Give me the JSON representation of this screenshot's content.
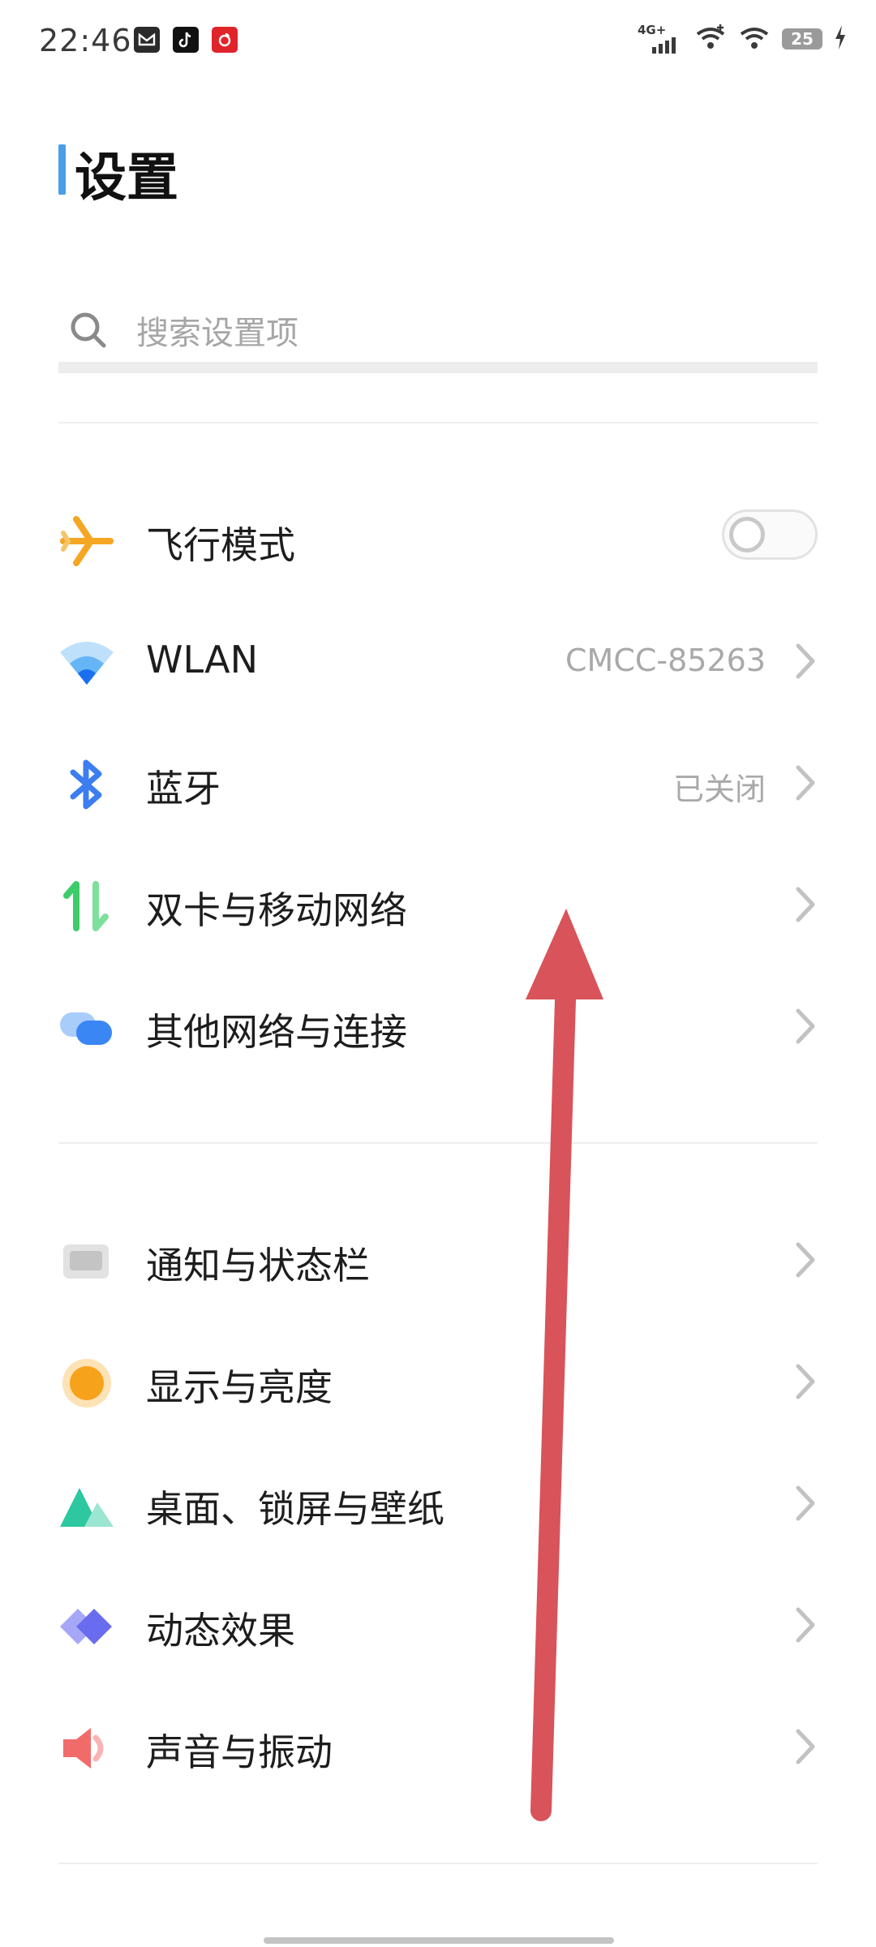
{
  "status_bar": {
    "time": "22:46",
    "network_label": "4G+",
    "battery_level": "25",
    "notification_icons": [
      "message-app-icon",
      "tiktok-app-icon",
      "netease-music-app-icon"
    ]
  },
  "page": {
    "title": "设置",
    "accent_color": "#4a9ee8"
  },
  "search": {
    "placeholder": "搜索设置项"
  },
  "settings": {
    "airplane": {
      "label": "飞行模式",
      "enabled": false,
      "icon": "airplane-icon",
      "color": "#f5a623"
    },
    "wlan": {
      "label": "WLAN",
      "value": "CMCC-85263",
      "icon": "wifi-icon",
      "color": "#2d7ff9"
    },
    "bluetooth": {
      "label": "蓝牙",
      "value": "已关闭",
      "icon": "bluetooth-icon",
      "color": "#3c7ef0"
    },
    "mobile": {
      "label": "双卡与移动网络",
      "icon": "mobile-data-icon",
      "color": "#3dcc6a"
    },
    "other_network": {
      "label": "其他网络与连接",
      "icon": "other-connections-icon",
      "color": "#3a86f5"
    },
    "notifications": {
      "label": "通知与状态栏",
      "icon": "notification-icon",
      "color": "#c4c4c4"
    },
    "display": {
      "label": "显示与亮度",
      "icon": "brightness-icon",
      "color": "#f7a21b"
    },
    "desktop": {
      "label": "桌面、锁屏与壁纸",
      "icon": "wallpaper-icon",
      "color": "#2dc7a0"
    },
    "motion": {
      "label": "动态效果",
      "icon": "motion-effects-icon",
      "color": "#6a6cf0"
    },
    "sound": {
      "label": "声音与振动",
      "icon": "sound-icon",
      "color": "#f26b6b"
    }
  },
  "overlay": {
    "gesture_arrow_color": "#d9535a"
  }
}
